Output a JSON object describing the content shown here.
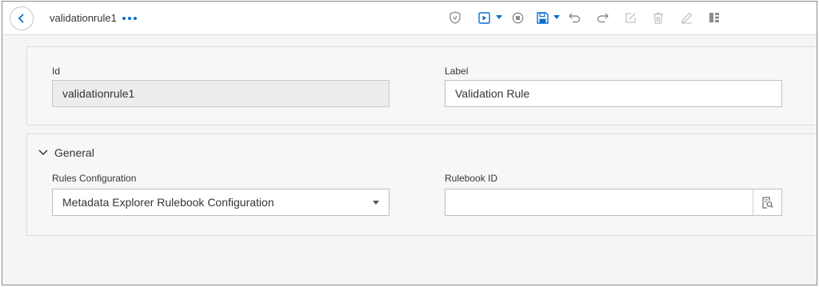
{
  "toolbar": {
    "title": "validationrule1",
    "icons": [
      "shield-icon",
      "play-icon",
      "stop-icon",
      "save-icon",
      "undo-icon",
      "redo-icon",
      "edit-box-icon",
      "trash-icon",
      "pencil-icon",
      "layout-icon"
    ]
  },
  "header_section": {
    "id_label": "Id",
    "id_value": "validationrule1",
    "label_label": "Label",
    "label_value": "Validation Rule"
  },
  "general": {
    "heading": "General",
    "rules_config_label": "Rules Configuration",
    "rules_config_value": "Metadata Explorer Rulebook Configuration",
    "rulebook_id_label": "Rulebook ID",
    "rulebook_id_value": ""
  },
  "colors": {
    "accent": "#0a6ed1",
    "icon_gray": "#8c8c8c",
    "icon_light": "#c4c4c4"
  }
}
